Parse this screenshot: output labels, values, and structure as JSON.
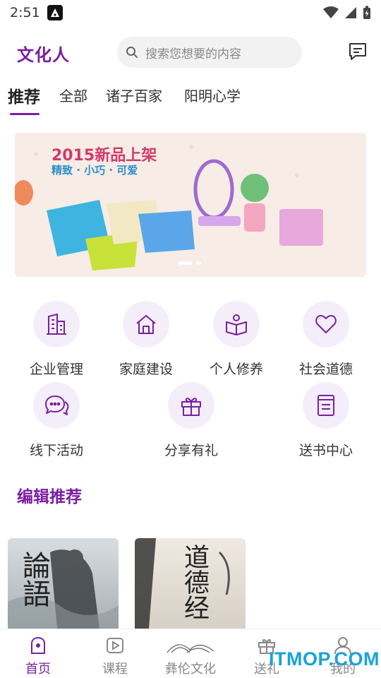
{
  "status": {
    "time": "2:51"
  },
  "header": {
    "logo": "文化人",
    "search_placeholder": "搜索您想要的内容"
  },
  "tabs": [
    {
      "label": "推荐"
    },
    {
      "label": "全部"
    },
    {
      "label": "诸子百家"
    },
    {
      "label": "阳明心学"
    }
  ],
  "banner": {
    "title": "2015新品上架",
    "subtitle": "精致 · 小巧 · 可爱",
    "slides": 2,
    "active_slide": 1
  },
  "categories": [
    {
      "label": "企业管理",
      "icon": "building-icon"
    },
    {
      "label": "家庭建设",
      "icon": "home-icon"
    },
    {
      "label": "个人修养",
      "icon": "book-icon"
    },
    {
      "label": "社会道德",
      "icon": "heart-icon"
    },
    {
      "label": "线下活动",
      "icon": "chat-icon"
    },
    {
      "label": "分享有礼",
      "icon": "gift-icon"
    },
    {
      "label": "送书中心",
      "icon": "document-icon"
    }
  ],
  "section": {
    "title": "编辑推荐"
  },
  "books": [
    {
      "chars": "論語"
    },
    {
      "chars": "道德经"
    }
  ],
  "bottom_nav": [
    {
      "label": "首页",
      "icon": "home-nav-icon",
      "active": true
    },
    {
      "label": "课程",
      "icon": "play-icon",
      "active": false
    },
    {
      "label": "彝伦文化",
      "icon": "mountain-logo-icon",
      "active": false
    },
    {
      "label": "送礼",
      "icon": "gift-nav-icon",
      "active": false
    },
    {
      "label": "我的",
      "icon": "user-icon",
      "active": false
    }
  ],
  "watermark": "ITMOP.COM",
  "colors": {
    "accent": "#7a1fa2",
    "accent_light": "#f4eefa"
  }
}
